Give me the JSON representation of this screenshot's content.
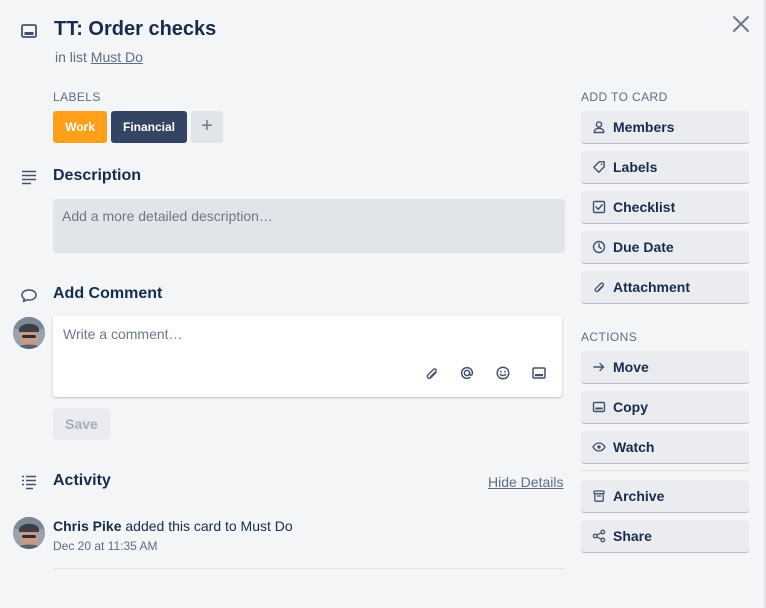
{
  "card": {
    "title": "TT: Order checks",
    "in_list_prefix": "in list",
    "list_name": "Must Do"
  },
  "labels": {
    "heading": "LABELS",
    "items": [
      {
        "text": "Work",
        "color": "#ff9f1a"
      },
      {
        "text": "Financial",
        "color": "#344563"
      }
    ],
    "add_symbol": "+"
  },
  "description": {
    "heading": "Description",
    "placeholder": "Add a more detailed description…"
  },
  "comment": {
    "heading": "Add Comment",
    "placeholder": "Write a comment…",
    "toolbar_icons": [
      "attachment-icon",
      "mention-icon",
      "emoji-icon",
      "card-icon"
    ],
    "save_label": "Save"
  },
  "activity": {
    "heading": "Activity",
    "toggle_label": "Hide Details",
    "entries": [
      {
        "user": "Chris Pike",
        "action": "added this card to Must Do",
        "date": "Dec 20 at 11:35 AM"
      }
    ]
  },
  "sidebar": {
    "add_to_card_heading": "ADD TO CARD",
    "add_to_card": [
      {
        "label": "Members",
        "icon": "member-icon"
      },
      {
        "label": "Labels",
        "icon": "label-tag-icon"
      },
      {
        "label": "Checklist",
        "icon": "checklist-icon"
      },
      {
        "label": "Due Date",
        "icon": "clock-icon"
      },
      {
        "label": "Attachment",
        "icon": "paperclip-icon"
      }
    ],
    "actions_heading": "ACTIONS",
    "actions": [
      {
        "label": "Move",
        "icon": "arrow-right-icon"
      },
      {
        "label": "Copy",
        "icon": "copy-card-icon"
      },
      {
        "label": "Watch",
        "icon": "eye-icon"
      },
      {
        "label": "Archive",
        "icon": "archive-icon"
      },
      {
        "label": "Share",
        "icon": "share-icon"
      }
    ]
  }
}
